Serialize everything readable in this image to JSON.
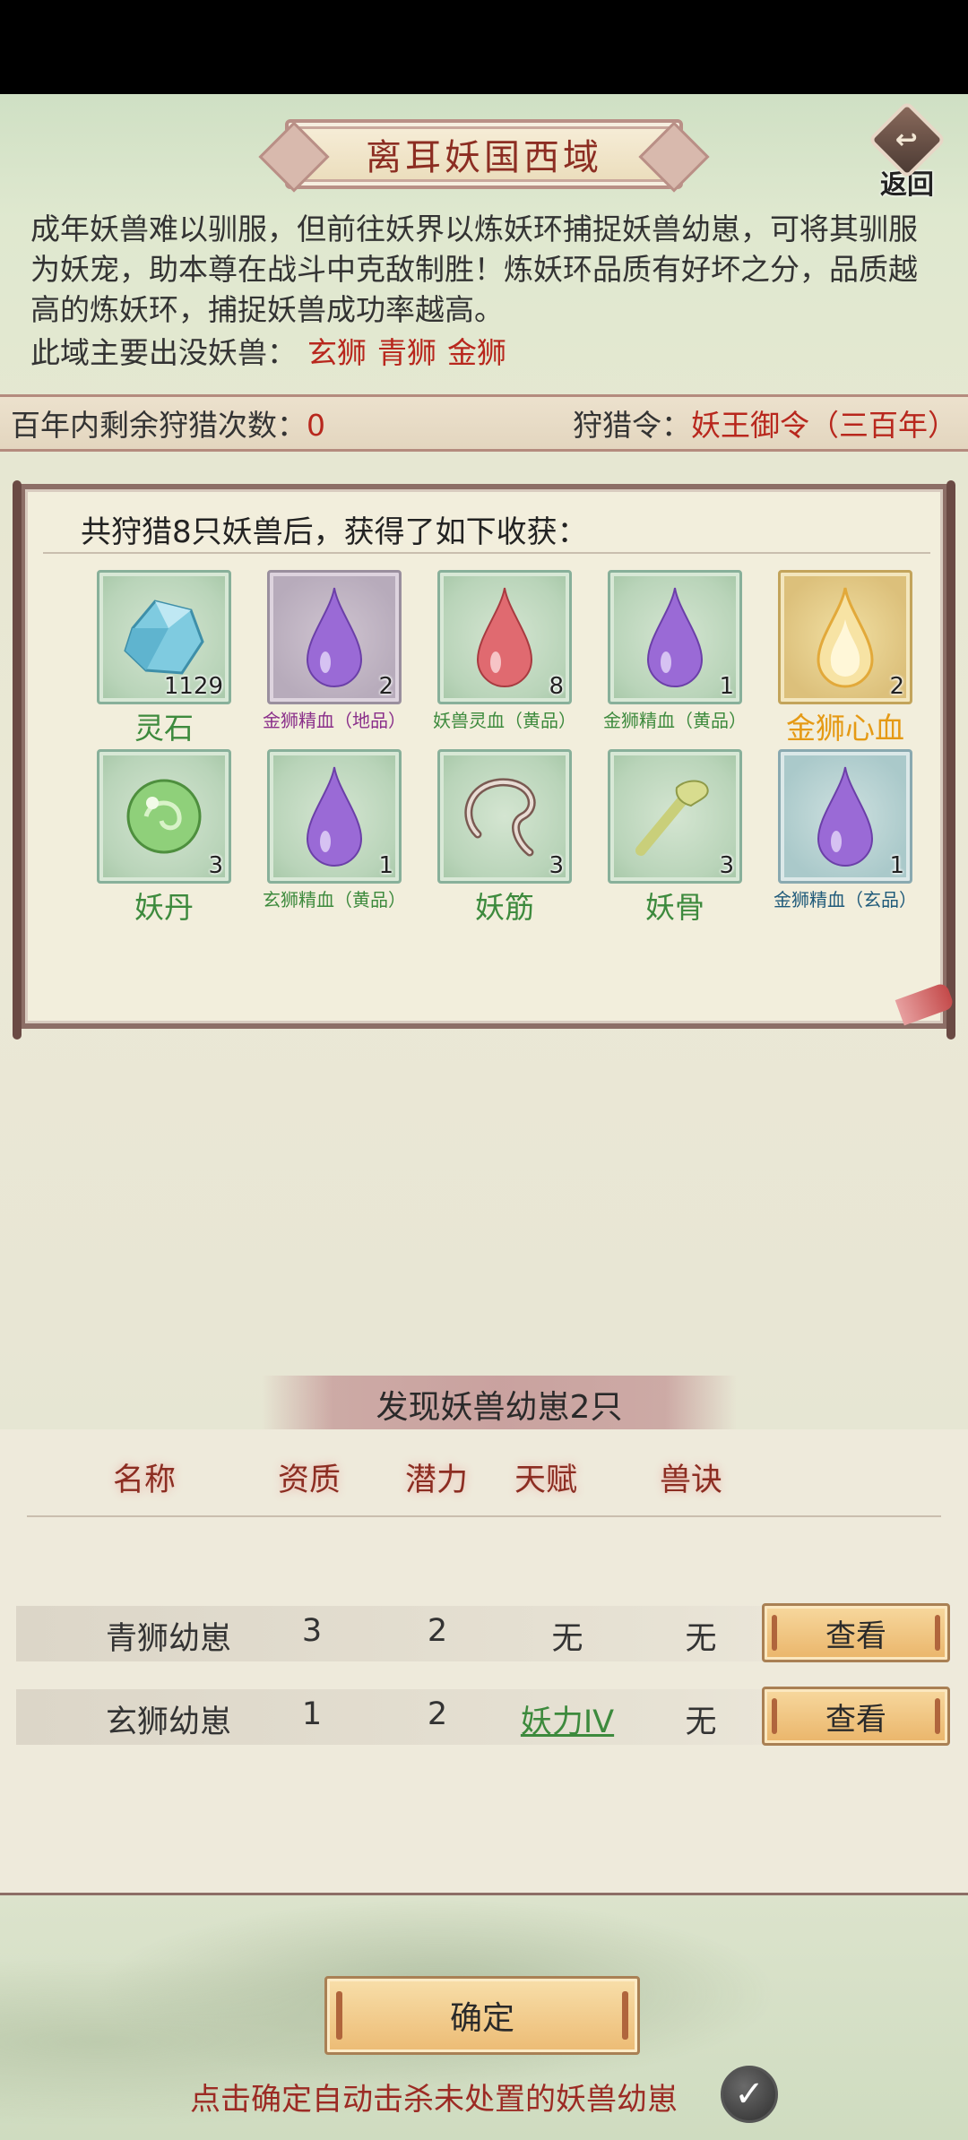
{
  "header": {
    "title": "离耳妖国西域",
    "back_label": "返回",
    "back_icon": "back-arrow-icon"
  },
  "description": {
    "text": "成年妖兽难以驯服，但前往妖界以炼妖环捕捉妖兽幼崽，可将其驯服为妖宠，助本尊在战斗中克敌制胜！炼妖环品质有好坏之分，品质越高的炼妖环，捕捉妖兽成功率越高。",
    "beasts_label": "此域主要出没妖兽：",
    "beasts": [
      "玄狮",
      "青狮",
      "金狮"
    ]
  },
  "hunt_bar": {
    "remaining_label": "百年内剩余狩猎次数：",
    "remaining_value": "0",
    "token_label": "狩猎令：",
    "token_value": "妖王御令（三百年）"
  },
  "rewards": {
    "header": "共狩猎8只妖兽后，获得了如下收获：",
    "items": [
      {
        "name": "灵石",
        "count": "1129",
        "icon": "spirit-stone-icon",
        "quality": "green",
        "big": true
      },
      {
        "name": "金狮精血（地品）",
        "count": "2",
        "icon": "purple-blood-drop-icon",
        "quality": "purple",
        "big": false
      },
      {
        "name": "妖兽灵血（黄品）",
        "count": "8",
        "icon": "red-blood-drop-icon",
        "quality": "green",
        "big": false
      },
      {
        "name": "金狮精血（黄品）",
        "count": "1",
        "icon": "purple-blood-drop-icon",
        "quality": "green",
        "big": false
      },
      {
        "name": "金狮心血",
        "count": "2",
        "icon": "golden-flame-drop-icon",
        "quality": "gold",
        "big": true
      },
      {
        "name": "妖丹",
        "count": "3",
        "icon": "demon-core-orb-icon",
        "quality": "green",
        "big": true
      },
      {
        "name": "玄狮精血（黄品）",
        "count": "1",
        "icon": "purple-blood-drop-icon",
        "quality": "green",
        "big": false
      },
      {
        "name": "妖筋",
        "count": "3",
        "icon": "demon-tendon-icon",
        "quality": "green",
        "big": true
      },
      {
        "name": "妖骨",
        "count": "3",
        "icon": "demon-bone-icon",
        "quality": "green",
        "big": true
      },
      {
        "name": "金狮精血（玄品）",
        "count": "1",
        "icon": "purple-blood-drop-icon",
        "quality": "blue",
        "big": false
      }
    ]
  },
  "cubs": {
    "title": "发现妖兽幼崽2只",
    "headers": {
      "name": "名称",
      "aptitude": "资质",
      "potential": "潜力",
      "talent": "天赋",
      "skill": "兽诀"
    },
    "rows": [
      {
        "name": "青狮幼崽",
        "aptitude": "3",
        "potential": "2",
        "talent": "无",
        "skill": "无",
        "talent_link": false,
        "view_label": "查看"
      },
      {
        "name": "玄狮幼崽",
        "aptitude": "1",
        "potential": "2",
        "talent": "妖力IV",
        "skill": "无",
        "talent_link": true,
        "view_label": "查看"
      }
    ]
  },
  "footer": {
    "confirm_label": "确定",
    "auto_kill_label": "点击确定自动击杀未处置的妖兽幼崽",
    "auto_kill_checked": true
  },
  "colors": {
    "title_red": "#8c2d22",
    "highlight_red": "#b8271d",
    "quality_green": "#3d8a3d",
    "quality_purple": "#8a2f8a",
    "quality_gold": "#e59a15",
    "quality_blue": "#1f5a7a"
  }
}
